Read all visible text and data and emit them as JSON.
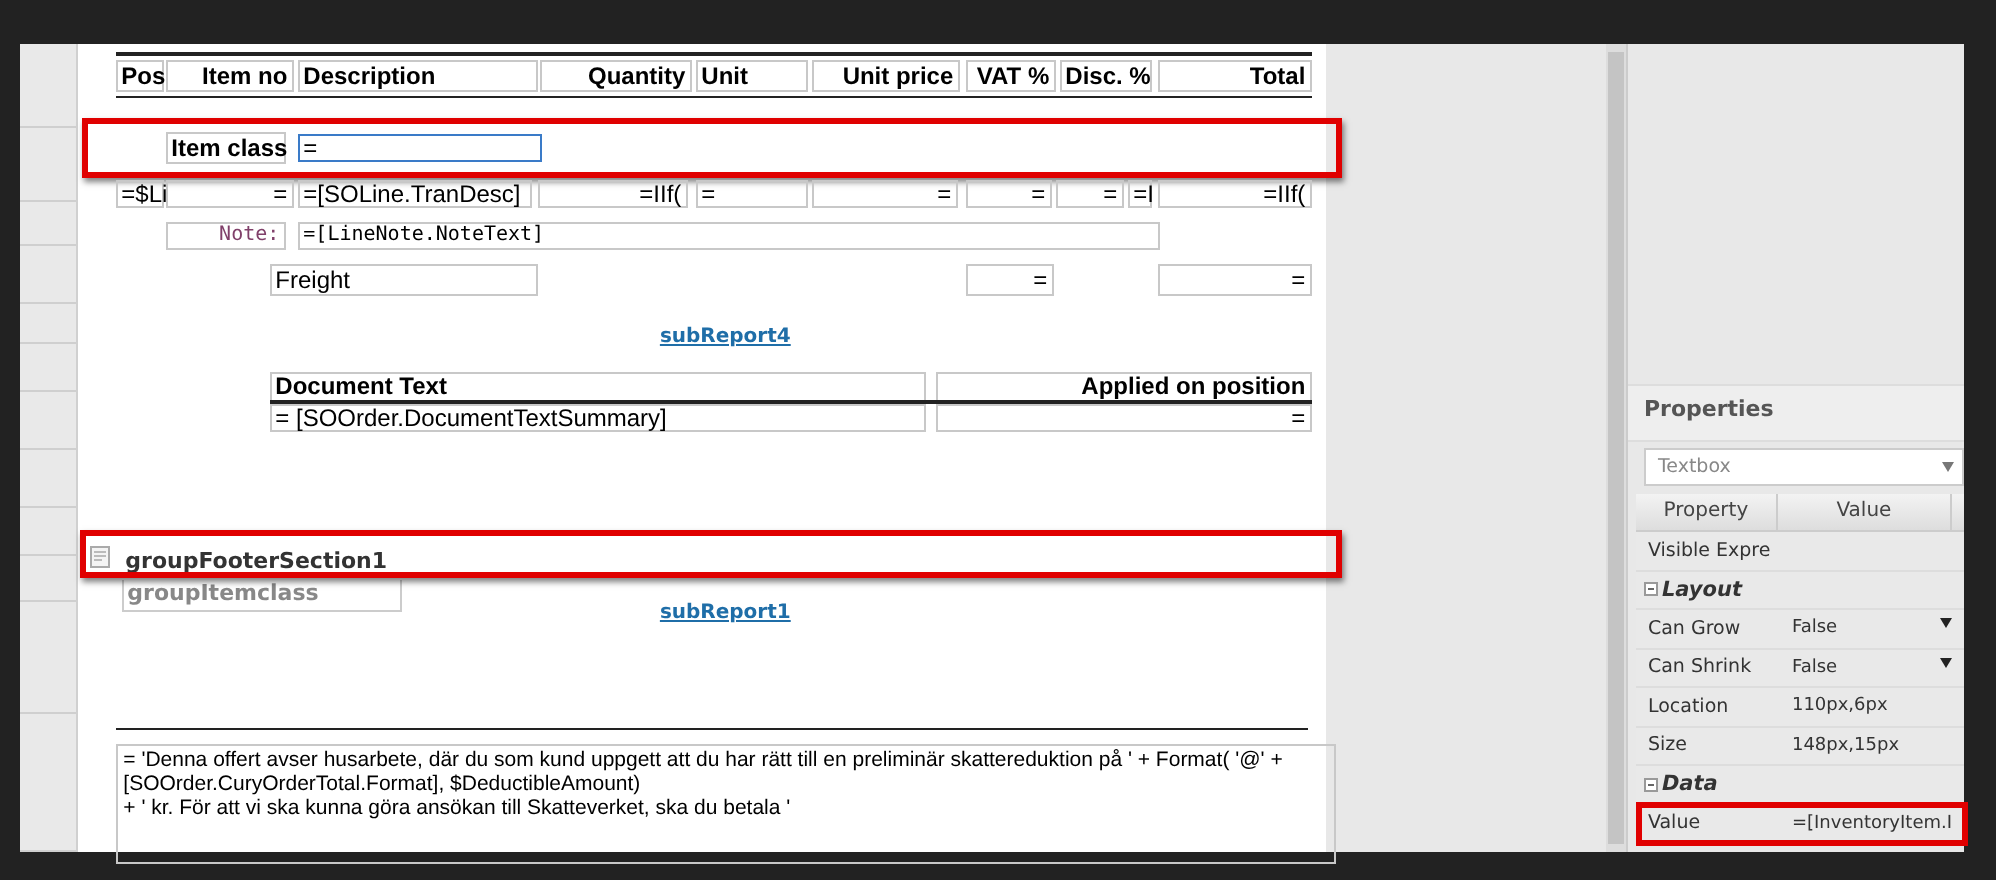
{
  "header_columns": [
    "Pos",
    "Item no",
    "Description",
    "Quantity",
    "Unit",
    "Unit price",
    "VAT %",
    "Disc. %",
    "Total"
  ],
  "group_header": {
    "label": "Item class",
    "value": "=",
    "selected": true
  },
  "detail_row": [
    "=$Li",
    "=",
    "=[SOLine.TranDesc]",
    "=IIf(",
    "=",
    "=",
    "=",
    "=",
    "=I",
    "=IIf("
  ],
  "note": {
    "label": "Note:",
    "value": "=[LineNote.NoteText]"
  },
  "freight_row": [
    "Freight",
    "=",
    "="
  ],
  "subreport_top": "subReport4",
  "document_text": {
    "columns": [
      "Document Text",
      "Applied on position"
    ],
    "values": [
      "= [SOOrder.DocumentTextSummary]",
      "="
    ]
  },
  "group_footer": {
    "title": "groupFooterSection1",
    "subtitle": "groupItemclass",
    "selected": true
  },
  "subreport_bottom": "subReport1",
  "footer_text": [
    "= 'Denna offert avser husarbete, där du som kund uppgett att du har rätt till en preliminär skattereduktion på ' + Format( '@' +",
    "[SOOrder.CuryOrderTotal.Format], $DeductibleAmount)",
    "+ ' kr. För att vi ska kunna göra ansökan till Skatteverket, ska du betala '"
  ],
  "properties": {
    "title": "Properties",
    "object_type": "Textbox",
    "columns": [
      "Property",
      "Value"
    ],
    "rows": [
      {
        "kind": "row",
        "name": "Visible Expre"
      },
      {
        "kind": "group",
        "name": "Layout"
      },
      {
        "kind": "dropdown",
        "name": "Can Grow",
        "value": "False"
      },
      {
        "kind": "dropdown",
        "name": "Can Shrink",
        "value": "False"
      },
      {
        "kind": "row",
        "name": "Location",
        "value": "110px,6px"
      },
      {
        "kind": "row",
        "name": "Size",
        "value": "148px,15px"
      },
      {
        "kind": "group",
        "name": "Data"
      },
      {
        "kind": "row",
        "name": "Value",
        "value": "=[InventoryItem.I",
        "selected": true
      }
    ]
  }
}
